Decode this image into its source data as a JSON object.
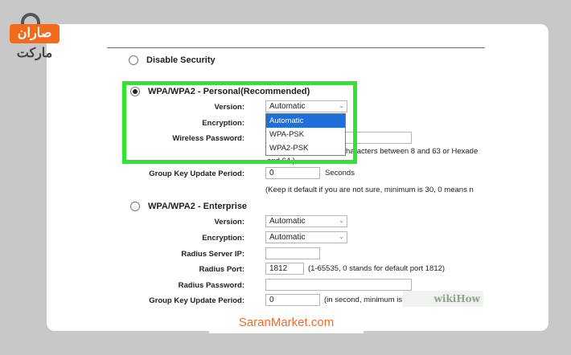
{
  "watermark_logo": {
    "line1": "صاران",
    "line2": "مارکت"
  },
  "brand_footer": "SaranMarket.com",
  "wikihow": "wikiHow",
  "disable": {
    "label": "Disable Security"
  },
  "personal": {
    "title": "WPA/WPA2 - Personal(Recommended)",
    "version_label": "Version:",
    "version_value": "Automatic",
    "encryption_label": "Encryption:",
    "password_label": "Wireless Password:",
    "password_note": "haracters between 8 and 63 or Hexade",
    "password_note2": "and 64.)",
    "gkup_label": "Group Key Update Period:",
    "gkup_value": "0",
    "gkup_unit": "Seconds",
    "gkup_note": "(Keep it default if you are not sure, minimum is 30, 0 means n",
    "dropdown_options": [
      "Automatic",
      "WPA-PSK",
      "WPA2-PSK"
    ],
    "highlight_color": "#2ee62e"
  },
  "enterprise": {
    "title": "WPA/WPA2 - Enterprise",
    "version_label": "Version:",
    "version_value": "Automatic",
    "encryption_label": "Encryption:",
    "encryption_value": "Automatic",
    "radius_ip_label": "Radius Server IP:",
    "radius_port_label": "Radius Port:",
    "radius_port_value": "1812",
    "radius_port_note": "(1-65535, 0 stands for default port 1812)",
    "radius_pw_label": "Radius Password:",
    "gkup_label": "Group Key Update Period:",
    "gkup_value": "0",
    "gkup_note": "(in second, minimum is 30,"
  }
}
